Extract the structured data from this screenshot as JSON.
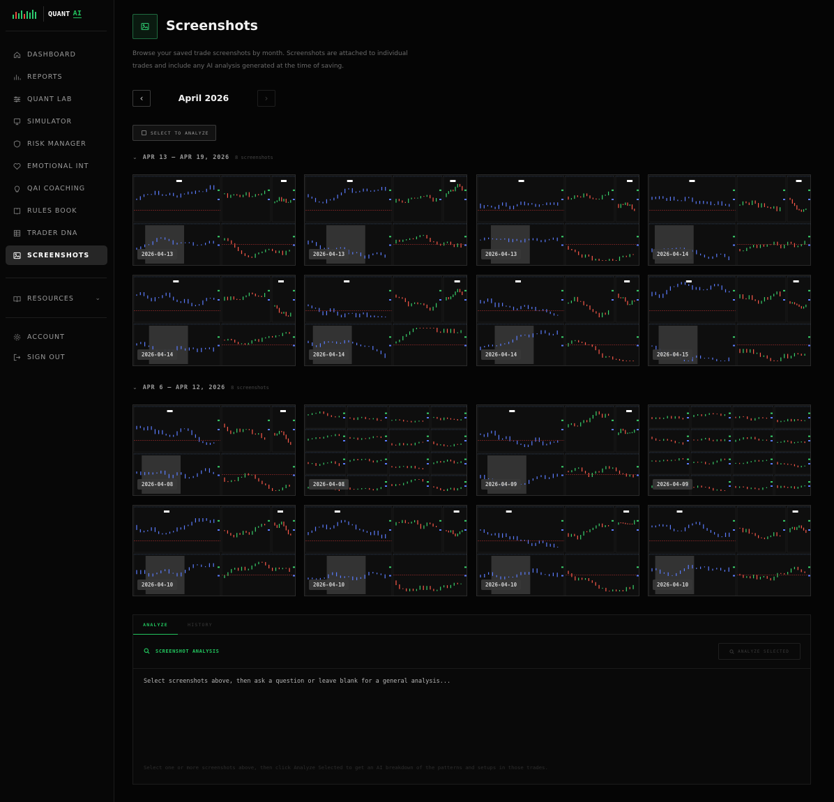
{
  "brand": {
    "name": "QUANT",
    "suffix": "AI"
  },
  "nav": [
    {
      "label": "DASHBOARD",
      "icon": "home-icon"
    },
    {
      "label": "REPORTS",
      "icon": "bar-chart-icon"
    },
    {
      "label": "QUANT LAB",
      "icon": "sliders-icon"
    },
    {
      "label": "SIMULATOR",
      "icon": "monitor-icon"
    },
    {
      "label": "RISK MANAGER",
      "icon": "shield-icon"
    },
    {
      "label": "EMOTIONAL INT",
      "icon": "heart-icon"
    },
    {
      "label": "QAI COACHING",
      "icon": "lightbulb-icon"
    },
    {
      "label": "RULES BOOK",
      "icon": "book-icon"
    },
    {
      "label": "TRADER DNA",
      "icon": "table-icon"
    },
    {
      "label": "SCREENSHOTS",
      "icon": "image-icon",
      "active": true
    }
  ],
  "resources": {
    "label": "RESOURCES",
    "icon": "book-open-icon"
  },
  "account": [
    {
      "label": "ACCOUNT",
      "icon": "gear-icon"
    },
    {
      "label": "SIGN OUT",
      "icon": "sign-out-icon"
    }
  ],
  "page": {
    "title": "Screenshots",
    "description": "Browse your saved trade screenshots by month. Screenshots are attached to individual trades and include any AI analysis generated at the time of saving."
  },
  "month": {
    "label": "April 2026",
    "prev_icon": "chevron-left-icon",
    "next_icon": "chevron-right-icon"
  },
  "select_button": "SELECT TO ANALYZE",
  "weeks": [
    {
      "label": "APR 13 – APR 19, 2026",
      "count": "8 screenshots",
      "thumbs": [
        "2026-04-13",
        "2026-04-13",
        "2026-04-13",
        "2026-04-14",
        "2026-04-14",
        "2026-04-14",
        "2026-04-14",
        "2026-04-15"
      ]
    },
    {
      "label": "APR 6 – APR 12, 2026",
      "count": "8 screenshots",
      "thumbs": [
        "2026-04-08",
        "2026-04-08",
        "2026-04-09",
        "2026-04-09",
        "2026-04-10",
        "2026-04-10",
        "2026-04-10",
        "2026-04-10"
      ]
    }
  ],
  "panel": {
    "tabs": [
      "ANALYZE",
      "HISTORY"
    ],
    "title": "SCREENSHOT ANALYSIS",
    "analyze_button": "ANALYZE SELECTED",
    "prompt": "Select screenshots above, then ask a question or leave blank for a general analysis...",
    "hint": "Select one or more screenshots above, then click Analyze Selected to get an AI breakdown of the patterns and setups in those trades."
  },
  "colors": {
    "accent": "#22c55e",
    "background": "#050505",
    "panel": "#090909"
  }
}
